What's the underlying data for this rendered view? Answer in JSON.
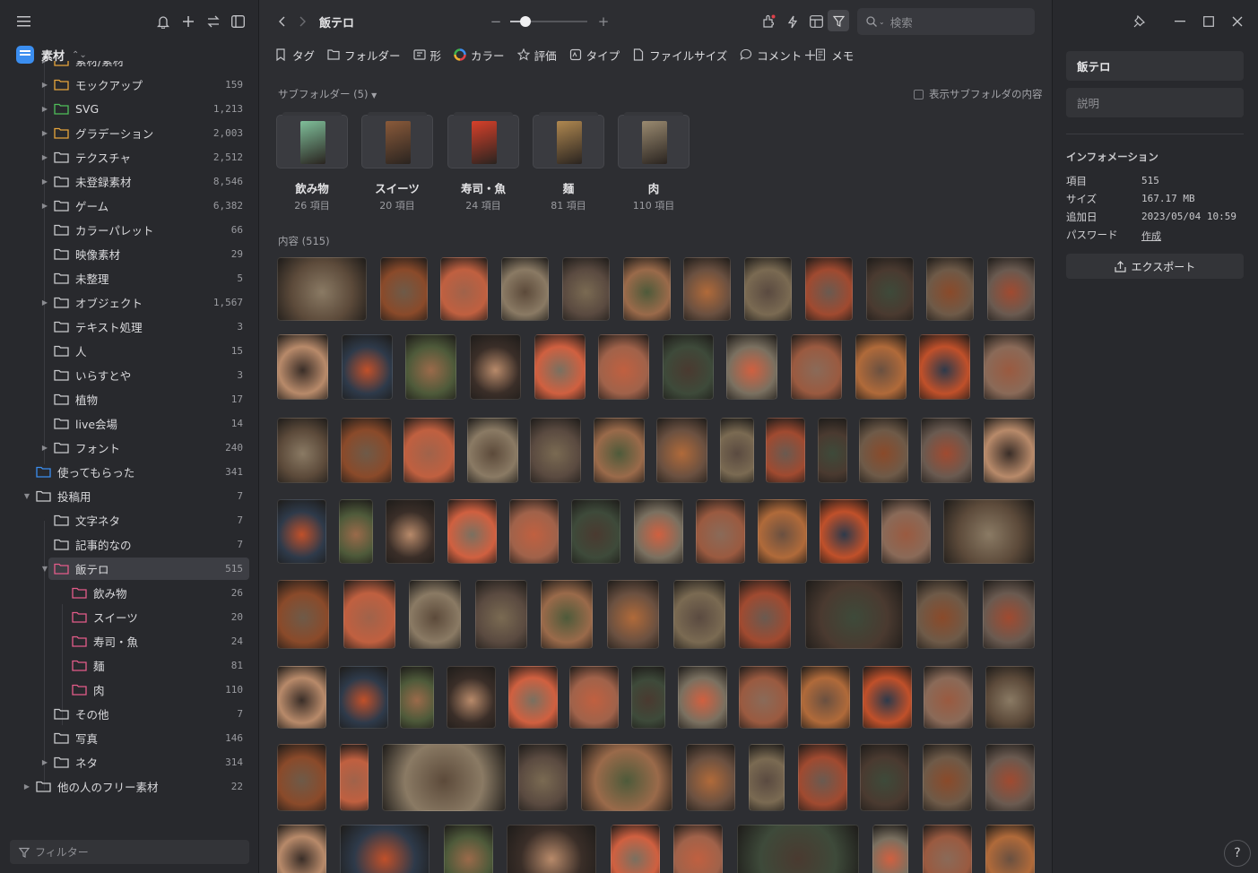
{
  "sidebar": {
    "library_name": "素材",
    "filter_placeholder": "フィルター",
    "tree": [
      {
        "label": "素材/素材",
        "count": "",
        "level": 1,
        "caret": "right",
        "color": "#e6a53c",
        "partial": true
      },
      {
        "label": "モックアップ",
        "count": "159",
        "level": 1,
        "caret": "right",
        "color": "#e6a53c"
      },
      {
        "label": "SVG",
        "count": "1,213",
        "level": 1,
        "caret": "right",
        "color": "#4fbf5a"
      },
      {
        "label": "グラデーション",
        "count": "2,003",
        "level": 1,
        "caret": "right",
        "color": "#e6a53c"
      },
      {
        "label": "テクスチャ",
        "count": "2,512",
        "level": 1,
        "caret": "right",
        "color": "#c9cacd"
      },
      {
        "label": "未登録素材",
        "count": "8,546",
        "level": 1,
        "caret": "right",
        "color": "#c9cacd"
      },
      {
        "label": "ゲーム",
        "count": "6,382",
        "level": 1,
        "caret": "right",
        "color": "#c9cacd"
      },
      {
        "label": "カラーパレット",
        "count": "66",
        "level": 1,
        "caret": "",
        "color": "#c9cacd"
      },
      {
        "label": "映像素材",
        "count": "29",
        "level": 1,
        "caret": "",
        "color": "#c9cacd"
      },
      {
        "label": "未整理",
        "count": "5",
        "level": 1,
        "caret": "",
        "color": "#c9cacd"
      },
      {
        "label": "オブジェクト",
        "count": "1,567",
        "level": 1,
        "caret": "right",
        "color": "#c9cacd"
      },
      {
        "label": "テキスト処理",
        "count": "3",
        "level": 1,
        "caret": "",
        "color": "#c9cacd"
      },
      {
        "label": "人",
        "count": "15",
        "level": 1,
        "caret": "",
        "color": "#c9cacd"
      },
      {
        "label": "いらすとや",
        "count": "3",
        "level": 1,
        "caret": "",
        "color": "#c9cacd"
      },
      {
        "label": "植物",
        "count": "17",
        "level": 1,
        "caret": "",
        "color": "#c9cacd"
      },
      {
        "label": "live会場",
        "count": "14",
        "level": 1,
        "caret": "",
        "color": "#c9cacd"
      },
      {
        "label": "フォント",
        "count": "240",
        "level": 1,
        "caret": "right",
        "color": "#c9cacd"
      },
      {
        "label": "使ってもらった",
        "count": "341",
        "level": 0,
        "caret": "",
        "color": "#3b8ef0"
      },
      {
        "label": "投稿用",
        "count": "7",
        "level": 0,
        "caret": "down",
        "color": "#c9cacd"
      },
      {
        "label": "文字ネタ",
        "count": "7",
        "level": 1,
        "caret": "",
        "color": "#c9cacd"
      },
      {
        "label": "記事的なの",
        "count": "7",
        "level": 1,
        "caret": "",
        "color": "#c9cacd"
      },
      {
        "label": "飯テロ",
        "count": "515",
        "level": 1,
        "caret": "down",
        "color": "#e45c8a",
        "selected": true
      },
      {
        "label": "飲み物",
        "count": "26",
        "level": 2,
        "caret": "",
        "color": "#e45c8a"
      },
      {
        "label": "スイーツ",
        "count": "20",
        "level": 2,
        "caret": "",
        "color": "#e45c8a"
      },
      {
        "label": "寿司・魚",
        "count": "24",
        "level": 2,
        "caret": "",
        "color": "#e45c8a"
      },
      {
        "label": "麺",
        "count": "81",
        "level": 2,
        "caret": "",
        "color": "#e45c8a"
      },
      {
        "label": "肉",
        "count": "110",
        "level": 2,
        "caret": "",
        "color": "#e45c8a"
      },
      {
        "label": "その他",
        "count": "7",
        "level": 1,
        "caret": "",
        "color": "#c9cacd"
      },
      {
        "label": "写真",
        "count": "146",
        "level": 1,
        "caret": "",
        "color": "#c9cacd"
      },
      {
        "label": "ネタ",
        "count": "314",
        "level": 1,
        "caret": "right",
        "color": "#c9cacd"
      },
      {
        "label": "他の人のフリー素材",
        "count": "22",
        "level": 0,
        "caret": "right",
        "color": "#c9cacd"
      }
    ]
  },
  "topbar": {
    "folder_title": "飯テロ",
    "zoom_level": 0.2,
    "search_placeholder": "検索"
  },
  "filters": [
    {
      "label": "タグ",
      "icon": "bookmark-icon"
    },
    {
      "label": "フォルダー",
      "icon": "folder-icon"
    },
    {
      "label": "形",
      "icon": "shape-icon"
    },
    {
      "label": "カラー",
      "icon": "color-wheel-icon"
    },
    {
      "label": "評価",
      "icon": "star-icon"
    },
    {
      "label": "タイプ",
      "icon": "file-type-icon"
    },
    {
      "label": "ファイルサイズ",
      "icon": "file-icon"
    },
    {
      "label": "コメント",
      "icon": "comment-icon"
    },
    {
      "label": "メモ",
      "icon": "memo-icon"
    }
  ],
  "subfolders": {
    "header": "サブフォルダー (5)",
    "show_contents_label": "表示サブフォルダの内容",
    "items": [
      {
        "name": "飲み物",
        "count": "26 項目",
        "color": "#7fbf9a"
      },
      {
        "name": "スイーツ",
        "count": "20 項目",
        "color": "#8a5a3a"
      },
      {
        "name": "寿司・魚",
        "count": "24 項目",
        "color": "#d8402a"
      },
      {
        "name": "麺",
        "count": "81 項目",
        "color": "#b08850"
      },
      {
        "name": "肉",
        "count": "110 項目",
        "color": "#9a8a70"
      }
    ]
  },
  "contents_header": "内容 (515)",
  "thumb_colors": [
    "#8a7a64",
    "#6e5a48",
    "#a0624a",
    "#5c4a3a",
    "#7a6a52",
    "#4e5a3a",
    "#b06a3a",
    "#5a4a40",
    "#6a5a50",
    "#3e4a3a",
    "#8a4a2a",
    "#a04a30",
    "#3a2e28",
    "#c0502a",
    "#9a6a4a",
    "#b88a6a",
    "#7a7060",
    "#c06040",
    "#4a3a30",
    "#d06040",
    "#8a6a58",
    "#6a5040",
    "#2e3a4a",
    "#9a5a40"
  ],
  "inspector": {
    "name_value": "飯テロ",
    "description_placeholder": "説明",
    "info_title": "インフォメーション",
    "info": [
      {
        "key": "項目",
        "value": "515"
      },
      {
        "key": "サイズ",
        "value": "167.17 MB"
      },
      {
        "key": "追加日",
        "value": "2023/05/04 10:59"
      },
      {
        "key": "パスワード",
        "value": "作成"
      }
    ],
    "export_label": "エクスポート",
    "help_label": "?"
  }
}
